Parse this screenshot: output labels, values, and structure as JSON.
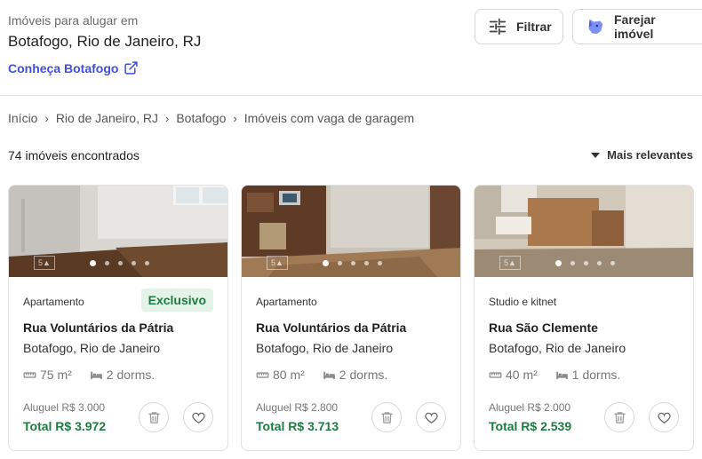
{
  "header": {
    "subtitle": "Imóveis para alugar em",
    "location": "Botafogo, Rio de Janeiro, RJ",
    "know_link": "Conheça Botafogo",
    "filter_label": "Filtrar",
    "sniff_label": "Farejar imóvel"
  },
  "breadcrumb": [
    "Início",
    "Rio de Janeiro, RJ",
    "Botafogo",
    "Imóveis com vaga de garagem"
  ],
  "results": {
    "count": "74 imóveis encontrados",
    "sort": "Mais relevantes"
  },
  "cards": [
    {
      "type": "Apartamento",
      "badge": "Exclusivo",
      "street": "Rua Voluntários da Pátria",
      "neighborhood": "Botafogo, Rio de Janeiro",
      "area": "75 m²",
      "bedrooms": "2 dorms.",
      "rent": "Aluguel R$ 3.000",
      "total": "Total R$ 3.972"
    },
    {
      "type": "Apartamento",
      "badge": "",
      "street": "Rua Voluntários da Pátria",
      "neighborhood": "Botafogo, Rio de Janeiro",
      "area": "80 m²",
      "bedrooms": "2 dorms.",
      "rent": "Aluguel R$ 2.800",
      "total": "Total R$ 3.713"
    },
    {
      "type": "Studio e kitnet",
      "badge": "",
      "street": "Rua São Clemente",
      "neighborhood": "Botafogo, Rio de Janeiro",
      "area": "40 m²",
      "bedrooms": "1 dorms.",
      "rent": "Aluguel R$ 2.000",
      "total": "Total R$ 2.539"
    }
  ],
  "colors": {
    "link": "#3f51d8",
    "price_green": "#1e7a42",
    "badge_bg": "#e3f3e8"
  },
  "icons": {
    "filter": "sliders-icon",
    "sniff": "dog-mascot-icon",
    "external": "external-link-icon",
    "area": "ruler-icon",
    "bed": "bed-icon",
    "trash": "trash-icon",
    "favorite": "heart-icon"
  }
}
